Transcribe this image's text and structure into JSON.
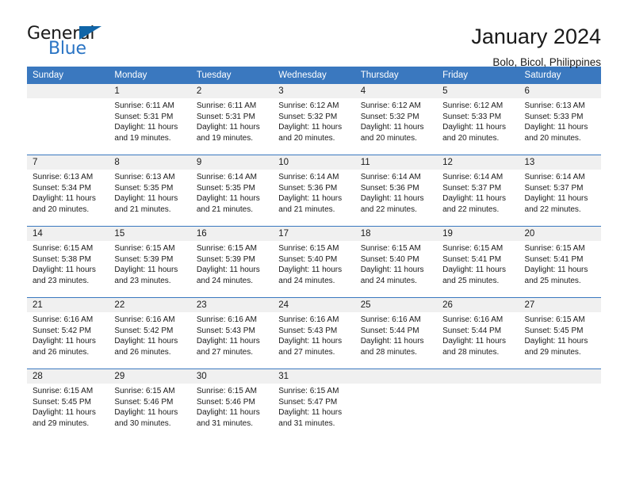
{
  "brand": {
    "name_part1": "General",
    "name_part2": "Blue",
    "mark": "triangle-flag-icon",
    "accent_color": "#1065a8",
    "blue_text_color": "#2a74c4"
  },
  "header": {
    "title": "January 2024",
    "subtitle": "Bolo, Bicol, Philippines"
  },
  "calendar": {
    "header_bg": "#3a78bf",
    "daynum_bg": "#f0f0f0",
    "weekday_headers": [
      "Sunday",
      "Monday",
      "Tuesday",
      "Wednesday",
      "Thursday",
      "Friday",
      "Saturday"
    ],
    "weeks": [
      [
        {
          "day": "",
          "sunrise": "",
          "sunset": "",
          "daylight_line1": "",
          "daylight_line2": ""
        },
        {
          "day": "1",
          "sunrise": "Sunrise: 6:11 AM",
          "sunset": "Sunset: 5:31 PM",
          "daylight_line1": "Daylight: 11 hours",
          "daylight_line2": "and 19 minutes."
        },
        {
          "day": "2",
          "sunrise": "Sunrise: 6:11 AM",
          "sunset": "Sunset: 5:31 PM",
          "daylight_line1": "Daylight: 11 hours",
          "daylight_line2": "and 19 minutes."
        },
        {
          "day": "3",
          "sunrise": "Sunrise: 6:12 AM",
          "sunset": "Sunset: 5:32 PM",
          "daylight_line1": "Daylight: 11 hours",
          "daylight_line2": "and 20 minutes."
        },
        {
          "day": "4",
          "sunrise": "Sunrise: 6:12 AM",
          "sunset": "Sunset: 5:32 PM",
          "daylight_line1": "Daylight: 11 hours",
          "daylight_line2": "and 20 minutes."
        },
        {
          "day": "5",
          "sunrise": "Sunrise: 6:12 AM",
          "sunset": "Sunset: 5:33 PM",
          "daylight_line1": "Daylight: 11 hours",
          "daylight_line2": "and 20 minutes."
        },
        {
          "day": "6",
          "sunrise": "Sunrise: 6:13 AM",
          "sunset": "Sunset: 5:33 PM",
          "daylight_line1": "Daylight: 11 hours",
          "daylight_line2": "and 20 minutes."
        }
      ],
      [
        {
          "day": "7",
          "sunrise": "Sunrise: 6:13 AM",
          "sunset": "Sunset: 5:34 PM",
          "daylight_line1": "Daylight: 11 hours",
          "daylight_line2": "and 20 minutes."
        },
        {
          "day": "8",
          "sunrise": "Sunrise: 6:13 AM",
          "sunset": "Sunset: 5:35 PM",
          "daylight_line1": "Daylight: 11 hours",
          "daylight_line2": "and 21 minutes."
        },
        {
          "day": "9",
          "sunrise": "Sunrise: 6:14 AM",
          "sunset": "Sunset: 5:35 PM",
          "daylight_line1": "Daylight: 11 hours",
          "daylight_line2": "and 21 minutes."
        },
        {
          "day": "10",
          "sunrise": "Sunrise: 6:14 AM",
          "sunset": "Sunset: 5:36 PM",
          "daylight_line1": "Daylight: 11 hours",
          "daylight_line2": "and 21 minutes."
        },
        {
          "day": "11",
          "sunrise": "Sunrise: 6:14 AM",
          "sunset": "Sunset: 5:36 PM",
          "daylight_line1": "Daylight: 11 hours",
          "daylight_line2": "and 22 minutes."
        },
        {
          "day": "12",
          "sunrise": "Sunrise: 6:14 AM",
          "sunset": "Sunset: 5:37 PM",
          "daylight_line1": "Daylight: 11 hours",
          "daylight_line2": "and 22 minutes."
        },
        {
          "day": "13",
          "sunrise": "Sunrise: 6:14 AM",
          "sunset": "Sunset: 5:37 PM",
          "daylight_line1": "Daylight: 11 hours",
          "daylight_line2": "and 22 minutes."
        }
      ],
      [
        {
          "day": "14",
          "sunrise": "Sunrise: 6:15 AM",
          "sunset": "Sunset: 5:38 PM",
          "daylight_line1": "Daylight: 11 hours",
          "daylight_line2": "and 23 minutes."
        },
        {
          "day": "15",
          "sunrise": "Sunrise: 6:15 AM",
          "sunset": "Sunset: 5:39 PM",
          "daylight_line1": "Daylight: 11 hours",
          "daylight_line2": "and 23 minutes."
        },
        {
          "day": "16",
          "sunrise": "Sunrise: 6:15 AM",
          "sunset": "Sunset: 5:39 PM",
          "daylight_line1": "Daylight: 11 hours",
          "daylight_line2": "and 24 minutes."
        },
        {
          "day": "17",
          "sunrise": "Sunrise: 6:15 AM",
          "sunset": "Sunset: 5:40 PM",
          "daylight_line1": "Daylight: 11 hours",
          "daylight_line2": "and 24 minutes."
        },
        {
          "day": "18",
          "sunrise": "Sunrise: 6:15 AM",
          "sunset": "Sunset: 5:40 PM",
          "daylight_line1": "Daylight: 11 hours",
          "daylight_line2": "and 24 minutes."
        },
        {
          "day": "19",
          "sunrise": "Sunrise: 6:15 AM",
          "sunset": "Sunset: 5:41 PM",
          "daylight_line1": "Daylight: 11 hours",
          "daylight_line2": "and 25 minutes."
        },
        {
          "day": "20",
          "sunrise": "Sunrise: 6:15 AM",
          "sunset": "Sunset: 5:41 PM",
          "daylight_line1": "Daylight: 11 hours",
          "daylight_line2": "and 25 minutes."
        }
      ],
      [
        {
          "day": "21",
          "sunrise": "Sunrise: 6:16 AM",
          "sunset": "Sunset: 5:42 PM",
          "daylight_line1": "Daylight: 11 hours",
          "daylight_line2": "and 26 minutes."
        },
        {
          "day": "22",
          "sunrise": "Sunrise: 6:16 AM",
          "sunset": "Sunset: 5:42 PM",
          "daylight_line1": "Daylight: 11 hours",
          "daylight_line2": "and 26 minutes."
        },
        {
          "day": "23",
          "sunrise": "Sunrise: 6:16 AM",
          "sunset": "Sunset: 5:43 PM",
          "daylight_line1": "Daylight: 11 hours",
          "daylight_line2": "and 27 minutes."
        },
        {
          "day": "24",
          "sunrise": "Sunrise: 6:16 AM",
          "sunset": "Sunset: 5:43 PM",
          "daylight_line1": "Daylight: 11 hours",
          "daylight_line2": "and 27 minutes."
        },
        {
          "day": "25",
          "sunrise": "Sunrise: 6:16 AM",
          "sunset": "Sunset: 5:44 PM",
          "daylight_line1": "Daylight: 11 hours",
          "daylight_line2": "and 28 minutes."
        },
        {
          "day": "26",
          "sunrise": "Sunrise: 6:16 AM",
          "sunset": "Sunset: 5:44 PM",
          "daylight_line1": "Daylight: 11 hours",
          "daylight_line2": "and 28 minutes."
        },
        {
          "day": "27",
          "sunrise": "Sunrise: 6:15 AM",
          "sunset": "Sunset: 5:45 PM",
          "daylight_line1": "Daylight: 11 hours",
          "daylight_line2": "and 29 minutes."
        }
      ],
      [
        {
          "day": "28",
          "sunrise": "Sunrise: 6:15 AM",
          "sunset": "Sunset: 5:45 PM",
          "daylight_line1": "Daylight: 11 hours",
          "daylight_line2": "and 29 minutes."
        },
        {
          "day": "29",
          "sunrise": "Sunrise: 6:15 AM",
          "sunset": "Sunset: 5:46 PM",
          "daylight_line1": "Daylight: 11 hours",
          "daylight_line2": "and 30 minutes."
        },
        {
          "day": "30",
          "sunrise": "Sunrise: 6:15 AM",
          "sunset": "Sunset: 5:46 PM",
          "daylight_line1": "Daylight: 11 hours",
          "daylight_line2": "and 31 minutes."
        },
        {
          "day": "31",
          "sunrise": "Sunrise: 6:15 AM",
          "sunset": "Sunset: 5:47 PM",
          "daylight_line1": "Daylight: 11 hours",
          "daylight_line2": "and 31 minutes."
        },
        {
          "day": "",
          "sunrise": "",
          "sunset": "",
          "daylight_line1": "",
          "daylight_line2": ""
        },
        {
          "day": "",
          "sunrise": "",
          "sunset": "",
          "daylight_line1": "",
          "daylight_line2": ""
        },
        {
          "day": "",
          "sunrise": "",
          "sunset": "",
          "daylight_line1": "",
          "daylight_line2": ""
        }
      ]
    ]
  }
}
